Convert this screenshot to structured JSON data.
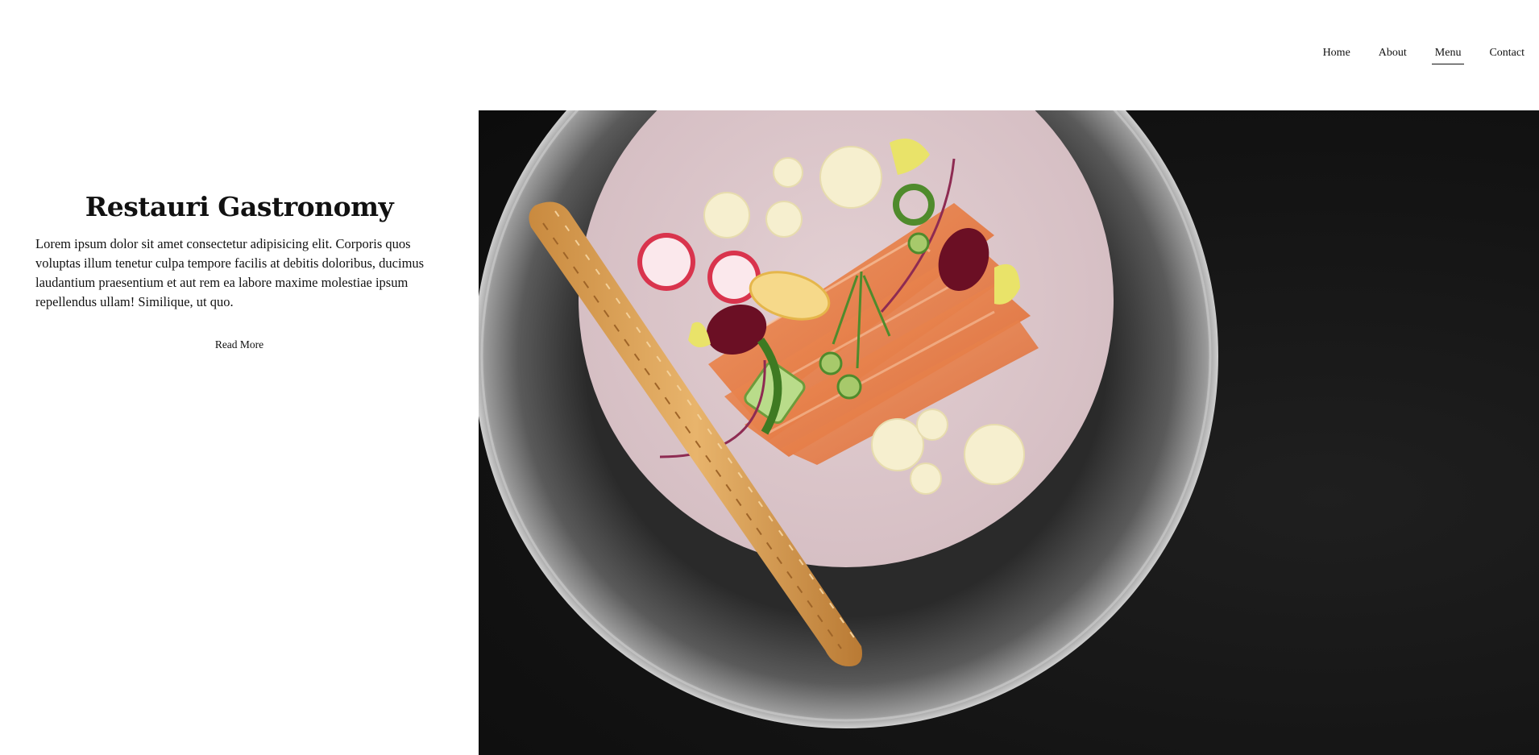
{
  "nav": {
    "items": [
      {
        "label": "Home",
        "active": false
      },
      {
        "label": "About",
        "active": false
      },
      {
        "label": "Menu",
        "active": true
      },
      {
        "label": "Contact",
        "active": false
      }
    ]
  },
  "intro": {
    "title": "Restauri Gastronomy",
    "body": "Lorem ipsum dolor sit amet consectetur adipisicing elit. Corporis quos voluptas illum tenetur culpa tempore facilis at debitis doloribus, ducimus laudantium praesentium et aut rem ea labore maxime molestiae ipsum repellendus ullam! Similique, ut quo.",
    "read_more_label": "Read More"
  },
  "hero": {
    "image_subject": "gourmet-salmon-plate-photo",
    "colors": {
      "background": "#141414",
      "plate_rim": "#6b6b6b",
      "plate_center": "#dcc7cb",
      "salmon": "#e47a45",
      "breadstick": "#d8a35a"
    }
  }
}
